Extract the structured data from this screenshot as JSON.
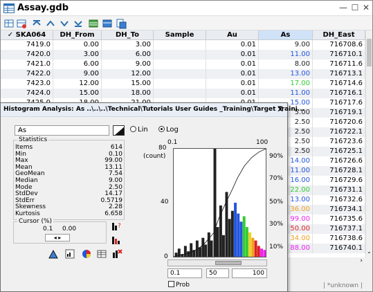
{
  "window": {
    "title": "Assay.gdb"
  },
  "colors": {
    "blue": "#2255dd",
    "green": "#33cc33",
    "orange": "#f0a020",
    "magenta": "#ee22ee",
    "red": "#dd2222",
    "black": "#222222"
  },
  "grid": {
    "columns": [
      "✓ SKA064",
      "DH_From",
      "DH_To",
      "Sample",
      "Au",
      "As",
      "DH_East"
    ],
    "rows": [
      {
        "row": "7419.0",
        "from": "0.00",
        "to": "3.00",
        "au": "0.01",
        "as": "9.00",
        "as_color": "black",
        "east": "716708.6"
      },
      {
        "row": "7420.0",
        "from": "3.00",
        "to": "6.00",
        "au": "0.01",
        "as": "11.00",
        "as_color": "blue",
        "east": "716710.1"
      },
      {
        "row": "7421.0",
        "from": "6.00",
        "to": "9.00",
        "au": "0.01",
        "as": "8.00",
        "as_color": "black",
        "east": "716711.6"
      },
      {
        "row": "7422.0",
        "from": "9.00",
        "to": "12.00",
        "au": "0.01",
        "as": "13.00",
        "as_color": "blue",
        "east": "716713.1"
      },
      {
        "row": "7423.0",
        "from": "12.00",
        "to": "15.00",
        "au": "0.01",
        "as": "17.00",
        "as_color": "green",
        "east": "716714.6"
      },
      {
        "row": "7424.0",
        "from": "15.00",
        "to": "18.00",
        "au": "0.01",
        "as": "11.00",
        "as_color": "blue",
        "east": "716716.1"
      },
      {
        "row": "7425.0",
        "from": "18.00",
        "to": "21.00",
        "au": "0.01",
        "as": "15.00",
        "as_color": "blue",
        "east": "716717.6"
      }
    ],
    "right_rows": [
      {
        "as": "5.00",
        "as_color": "black",
        "east": "716719.1"
      },
      {
        "as": "2.50",
        "as_color": "black",
        "east": "716720.6"
      },
      {
        "as": "2.50",
        "as_color": "black",
        "east": "716722.1"
      },
      {
        "as": "2.50",
        "as_color": "black",
        "east": "716723.6"
      },
      {
        "as": "2.50",
        "as_color": "black",
        "east": "716725.1"
      },
      {
        "as": "14.00",
        "as_color": "blue",
        "east": "716726.6"
      },
      {
        "as": "11.00",
        "as_color": "blue",
        "east": "716728.1"
      },
      {
        "as": "16.00",
        "as_color": "blue",
        "east": "716729.6"
      },
      {
        "as": "22.00",
        "as_color": "green",
        "east": "716731.1"
      },
      {
        "as": "13.00",
        "as_color": "blue",
        "east": "716732.6"
      },
      {
        "as": "36.00",
        "as_color": "orange",
        "east": "716734.1"
      },
      {
        "as": "99.00",
        "as_color": "magenta",
        "east": "716735.6"
      },
      {
        "as": "50.00",
        "as_color": "red",
        "east": "716737.1"
      },
      {
        "as": "34.00",
        "as_color": "orange",
        "east": "716738.6"
      },
      {
        "as": "88.00",
        "as_color": "magenta",
        "east": "716740.1"
      }
    ],
    "status_text": "| *unknown |"
  },
  "dialog": {
    "title": "Histogram Analysis: As ..\\..\\..\\Technical\\Tutorials  User Guides _Training\\Target Traini...",
    "close_glyph": "✕",
    "channel": "As",
    "scale_lin": "Lin",
    "scale_log": "Log",
    "selected_scale": "Log",
    "stats_label": "Statistics",
    "stats": [
      {
        "name": "Items",
        "value": "614"
      },
      {
        "name": "Min",
        "value": "0.10"
      },
      {
        "name": "Max",
        "value": "99.00"
      },
      {
        "name": "Mean",
        "value": "13.11"
      },
      {
        "name": "GeoMean",
        "value": "7.54"
      },
      {
        "name": "Median",
        "value": "9.00"
      },
      {
        "name": "Mode",
        "value": "2.50"
      },
      {
        "name": "StdDev",
        "value": "14.17"
      },
      {
        "name": "StdErr",
        "value": "0.5719"
      },
      {
        "name": "Skewness",
        "value": "2.28"
      },
      {
        "name": "Kurtosis",
        "value": "6.658"
      }
    ],
    "cursor_label": "Cursor (%)",
    "cursor_value1": "0.1",
    "cursor_value2": "0.00",
    "stepper": "◂ ▸",
    "x_min": "0.1",
    "x_max": "100",
    "y_max_label": "80",
    "y_unit": "(count)",
    "y_mid_label": "40",
    "y_zero_label": "0",
    "pct_labels": [
      "90%",
      "70%",
      "50%",
      "30%",
      "10%"
    ],
    "input_min": "0.1",
    "input_bins": "50",
    "input_max": "100",
    "prob_label": "Prob"
  },
  "chart_data": {
    "type": "bar",
    "title": "",
    "xlabel": "",
    "ylabel": "(count)",
    "x_scale": "log",
    "xlim": [
      0.1,
      100
    ],
    "ylim": [
      0,
      80
    ],
    "grid": false,
    "bins": [
      {
        "x": 0.12,
        "v": 3,
        "c": "#222"
      },
      {
        "x": 0.15,
        "v": 6,
        "c": "#222"
      },
      {
        "x": 0.19,
        "v": 2,
        "c": "#222"
      },
      {
        "x": 0.24,
        "v": 8,
        "c": "#222"
      },
      {
        "x": 0.3,
        "v": 4,
        "c": "#222"
      },
      {
        "x": 0.37,
        "v": 10,
        "c": "#222"
      },
      {
        "x": 0.46,
        "v": 5,
        "c": "#222"
      },
      {
        "x": 0.58,
        "v": 12,
        "c": "#222"
      },
      {
        "x": 0.72,
        "v": 7,
        "c": "#222"
      },
      {
        "x": 0.9,
        "v": 14,
        "c": "#222"
      },
      {
        "x": 1.1,
        "v": 9,
        "c": "#222"
      },
      {
        "x": 1.4,
        "v": 18,
        "c": "#222"
      },
      {
        "x": 1.7,
        "v": 12,
        "c": "#222"
      },
      {
        "x": 2.2,
        "v": 80,
        "c": "#222"
      },
      {
        "x": 2.7,
        "v": 22,
        "c": "#222"
      },
      {
        "x": 3.4,
        "v": 38,
        "c": "#222"
      },
      {
        "x": 4.2,
        "v": 16,
        "c": "#222"
      },
      {
        "x": 5.3,
        "v": 48,
        "c": "#222"
      },
      {
        "x": 6.6,
        "v": 28,
        "c": "#222"
      },
      {
        "x": 8.2,
        "v": 34,
        "c": "#222"
      },
      {
        "x": 10.2,
        "v": 40,
        "c": "#2255dd"
      },
      {
        "x": 12.7,
        "v": 32,
        "c": "#2255dd"
      },
      {
        "x": 15.8,
        "v": 26,
        "c": "#2255dd"
      },
      {
        "x": 19.7,
        "v": 30,
        "c": "#33cc33"
      },
      {
        "x": 24.5,
        "v": 22,
        "c": "#33cc33"
      },
      {
        "x": 30.5,
        "v": 18,
        "c": "#f0d020"
      },
      {
        "x": 38,
        "v": 14,
        "c": "#f0a020"
      },
      {
        "x": 47.3,
        "v": 12,
        "c": "#dd2222"
      },
      {
        "x": 59,
        "v": 8,
        "c": "#dd2222"
      },
      {
        "x": 73.4,
        "v": 6,
        "c": "#ee22ee"
      },
      {
        "x": 91.4,
        "v": 5,
        "c": "#ee22ee"
      }
    ],
    "cumulative_pct": [
      {
        "x": 0.1,
        "p": 0
      },
      {
        "x": 0.3,
        "p": 3
      },
      {
        "x": 0.6,
        "p": 7
      },
      {
        "x": 1,
        "p": 12
      },
      {
        "x": 2,
        "p": 22
      },
      {
        "x": 3,
        "p": 36
      },
      {
        "x": 5,
        "p": 50
      },
      {
        "x": 8,
        "p": 62
      },
      {
        "x": 12,
        "p": 73
      },
      {
        "x": 20,
        "p": 84
      },
      {
        "x": 35,
        "p": 92
      },
      {
        "x": 60,
        "p": 97
      },
      {
        "x": 100,
        "p": 100
      }
    ]
  }
}
